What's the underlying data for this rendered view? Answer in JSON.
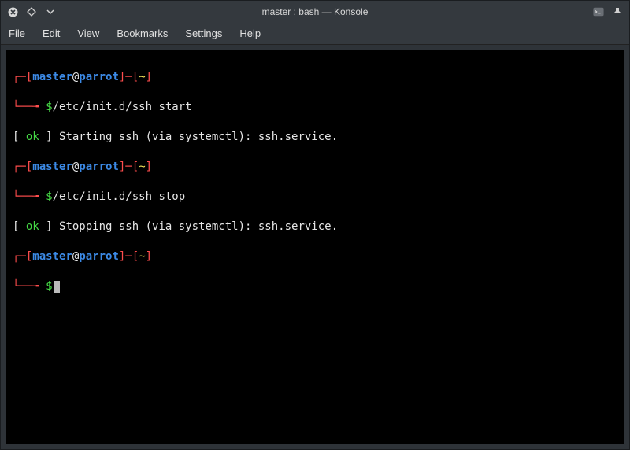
{
  "window": {
    "title": "master : bash — Konsole"
  },
  "menu": {
    "file": "File",
    "edit": "Edit",
    "view": "View",
    "bookmarks": "Bookmarks",
    "settings": "Settings",
    "help": "Help"
  },
  "term": {
    "p1_open": "┌─[",
    "p1_user": "master",
    "p1_at": "@",
    "p1_host": "parrot",
    "p1_close": "]─[",
    "p1_path": "~",
    "p1_close2": "]",
    "p2_branch": "└──╼",
    "p2_dollar": " $",
    "cmd1": "/etc/init.d/ssh start",
    "out1_open": "[",
    "out1_ok": " ok ",
    "out1_rest": "] Starting ssh (via systemctl): ssh.service.",
    "cmd2": "/etc/init.d/ssh stop",
    "out2_open": "[",
    "out2_ok": " ok ",
    "out2_rest": "] Stopping ssh (via systemctl): ssh.service."
  }
}
